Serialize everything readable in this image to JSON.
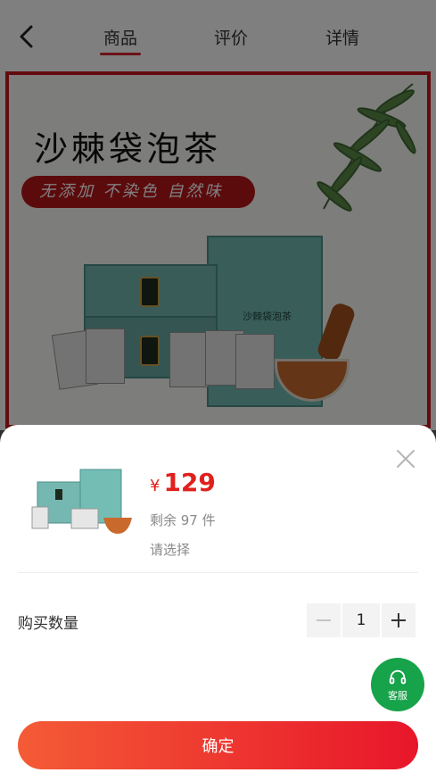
{
  "nav": {
    "tabs": [
      {
        "label": "商品"
      },
      {
        "label": "评价"
      },
      {
        "label": "详情"
      }
    ],
    "active_tab": "商品",
    "accent_color": "#d92430"
  },
  "banner": {
    "title": "沙棘袋泡茶",
    "tagline": "无添加 不染色 自然味",
    "bag_label": "沙棘袋泡茶",
    "badge_label": "沙棘"
  },
  "sheet": {
    "currency": "¥",
    "price": "129",
    "stock": "剩余 97 件",
    "select_hint": "请选择",
    "quantity_label": "购买数量",
    "quantity": "1",
    "service_label": "客服",
    "confirm_label": "确定",
    "price_color": "#e0201c",
    "service_color": "#16a34a"
  },
  "icons": [
    "back-arrow-icon",
    "close-icon",
    "minus-icon",
    "plus-icon",
    "headset-icon"
  ]
}
